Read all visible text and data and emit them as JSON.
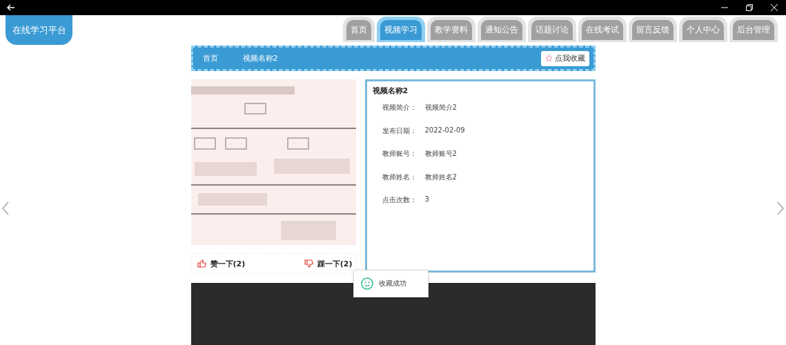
{
  "brand": "在线学习平台",
  "nav_tabs": [
    {
      "label": "首页",
      "selected": false
    },
    {
      "label": "视频学习",
      "selected": true
    },
    {
      "label": "教学资料",
      "selected": false
    },
    {
      "label": "通知公告",
      "selected": false
    },
    {
      "label": "话题讨论",
      "selected": false
    },
    {
      "label": "在线考试",
      "selected": false
    },
    {
      "label": "留言反馈",
      "selected": false
    },
    {
      "label": "个人中心",
      "selected": false
    },
    {
      "label": "后台管理",
      "selected": false
    }
  ],
  "breadcrumb": [
    "首页",
    "视频名称2"
  ],
  "favorite_button": {
    "label": "点我收藏"
  },
  "video_info": {
    "title": "视频名称2",
    "fields": [
      {
        "label": "视频简介：",
        "value": "视频简介2"
      },
      {
        "label": "发布日期：",
        "value": "2022-02-09"
      },
      {
        "label": "教师账号：",
        "value": "教师账号2"
      },
      {
        "label": "教师姓名：",
        "value": "教师姓名2"
      },
      {
        "label": "点击次数：",
        "value": "3"
      }
    ]
  },
  "votes": [
    {
      "kind": "up",
      "label": "赞一下(2)"
    },
    {
      "kind": "down",
      "label": "踩一下(2)"
    }
  ],
  "toast": {
    "message": "收藏成功"
  }
}
